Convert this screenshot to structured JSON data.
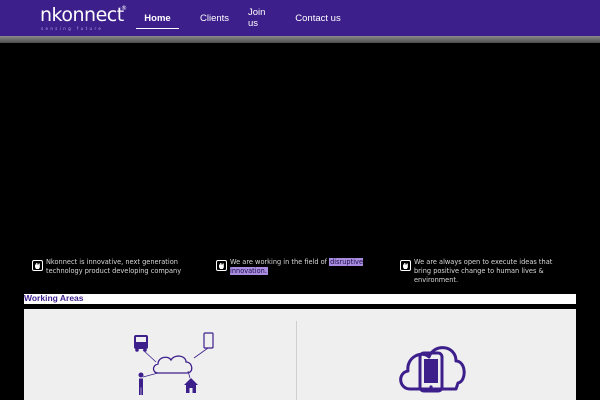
{
  "brand": {
    "name": "nkonnect",
    "reg": "®",
    "tagline": "sensing future"
  },
  "nav": {
    "items": [
      {
        "label": "Home",
        "active": true
      },
      {
        "label": "Clients",
        "active": false
      },
      {
        "label": "Join us",
        "active": false
      },
      {
        "label": "Contact us",
        "active": false
      }
    ]
  },
  "features": [
    {
      "icon": "hand-icon",
      "text": "Nkonnect is innovative, next generation technology product developing company"
    },
    {
      "icon": "hand-icon",
      "text_before": "We are working in the field of ",
      "highlight": "disruptive innovation."
    },
    {
      "icon": "hand-icon",
      "text": "We are always open to execute ideas that bring positive change to human lives & environment."
    }
  ],
  "working_areas": {
    "title": "Working Areas",
    "left_icon": "connected-devices-icon",
    "right_icon": "cloud-phone-icon"
  },
  "colors": {
    "brand": "#3d1f8c",
    "highlight": "#a98ce0",
    "panel": "#efefef"
  }
}
